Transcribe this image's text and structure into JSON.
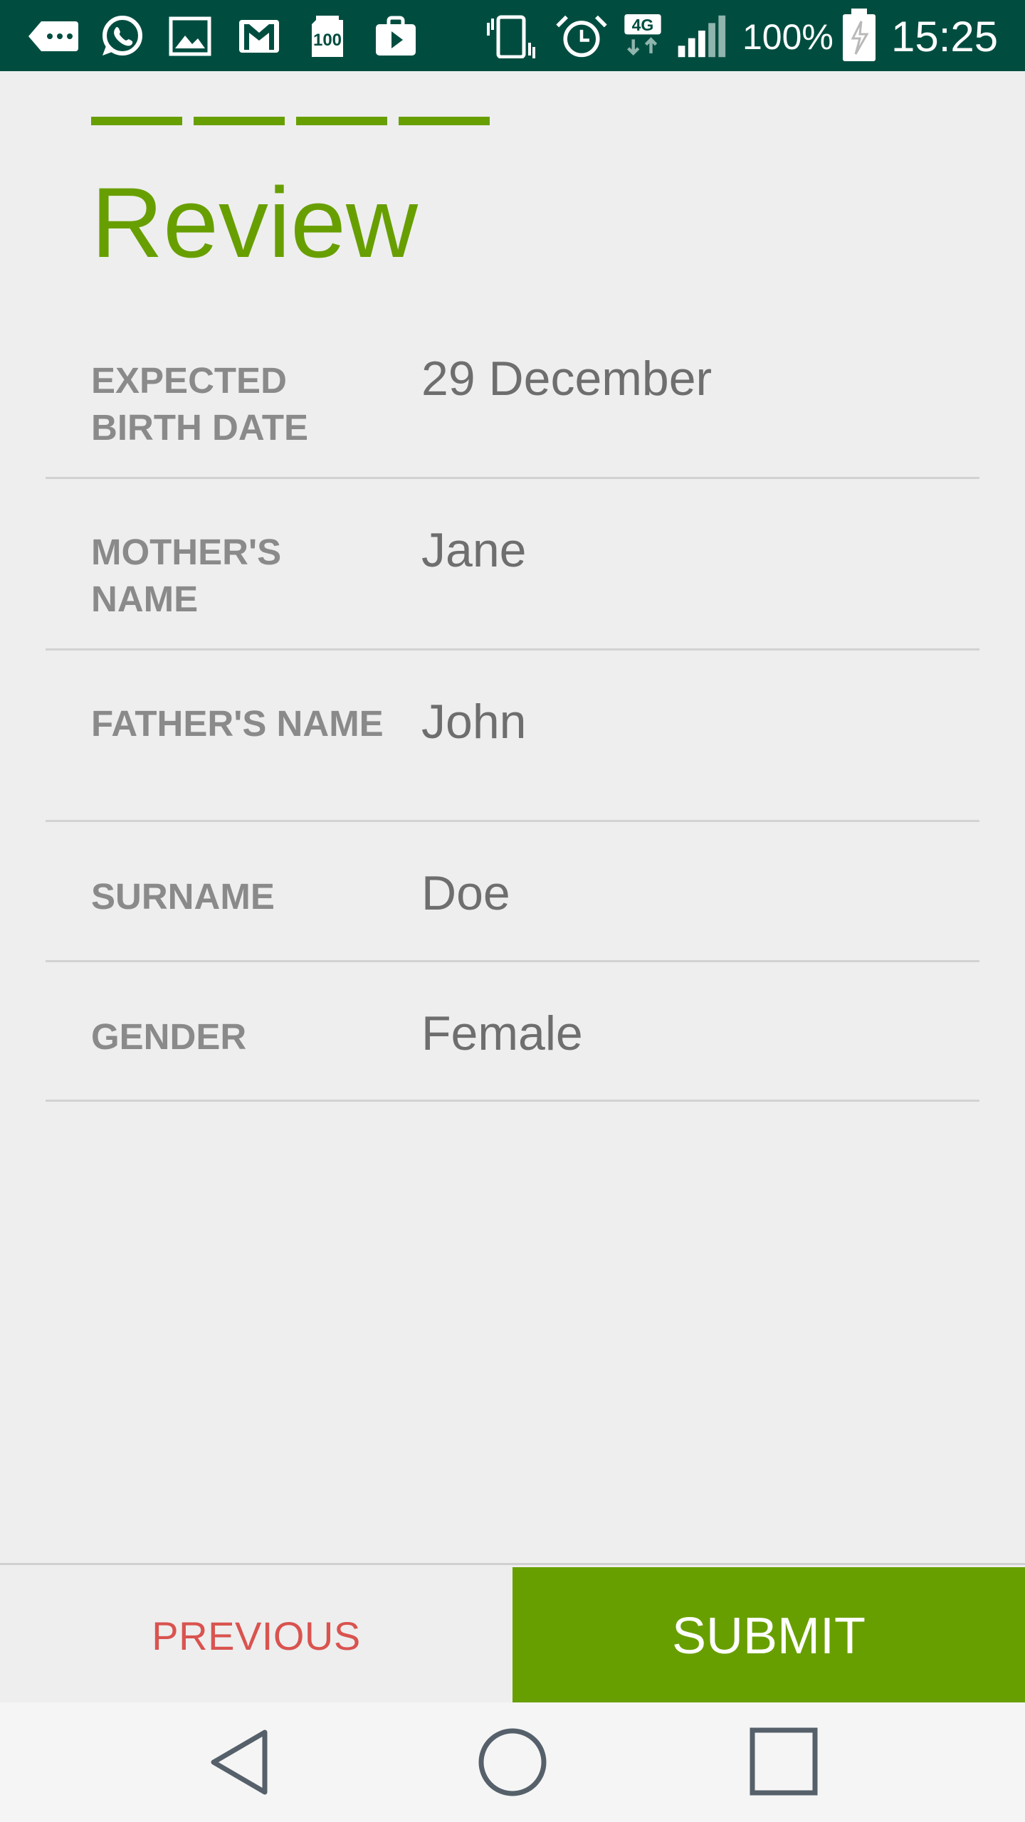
{
  "status_bar": {
    "battery_percent": "100%",
    "time": "15:25",
    "icons": [
      "notification-more-icon",
      "whatsapp-icon",
      "image-icon",
      "gmail-icon",
      "sd-card-100-icon",
      "play-store-icon",
      "vibrate-icon",
      "alarm-icon",
      "network-4g-icon",
      "signal-icon",
      "battery-charging-icon"
    ],
    "network_type": "4G",
    "sd_label": "100"
  },
  "colors": {
    "accent": "#689f00",
    "status_bar": "#004d40",
    "previous_text": "#d9534f",
    "background": "#eeeeee"
  },
  "progress": {
    "total_steps": 4,
    "completed_steps": 4
  },
  "page": {
    "title": "Review"
  },
  "review": {
    "rows": [
      {
        "label": "EXPECTED BIRTH DATE",
        "value": "29 December"
      },
      {
        "label": "MOTHER'S NAME",
        "value": "Jane"
      },
      {
        "label": "FATHER'S NAME",
        "value": "John"
      },
      {
        "label": "SURNAME",
        "value": "Doe"
      },
      {
        "label": "GENDER",
        "value": "Female"
      }
    ]
  },
  "actions": {
    "previous_label": "PREVIOUS",
    "submit_label": "SUBMIT"
  },
  "nav": {
    "items": [
      "back-icon",
      "home-icon",
      "recents-icon"
    ]
  }
}
